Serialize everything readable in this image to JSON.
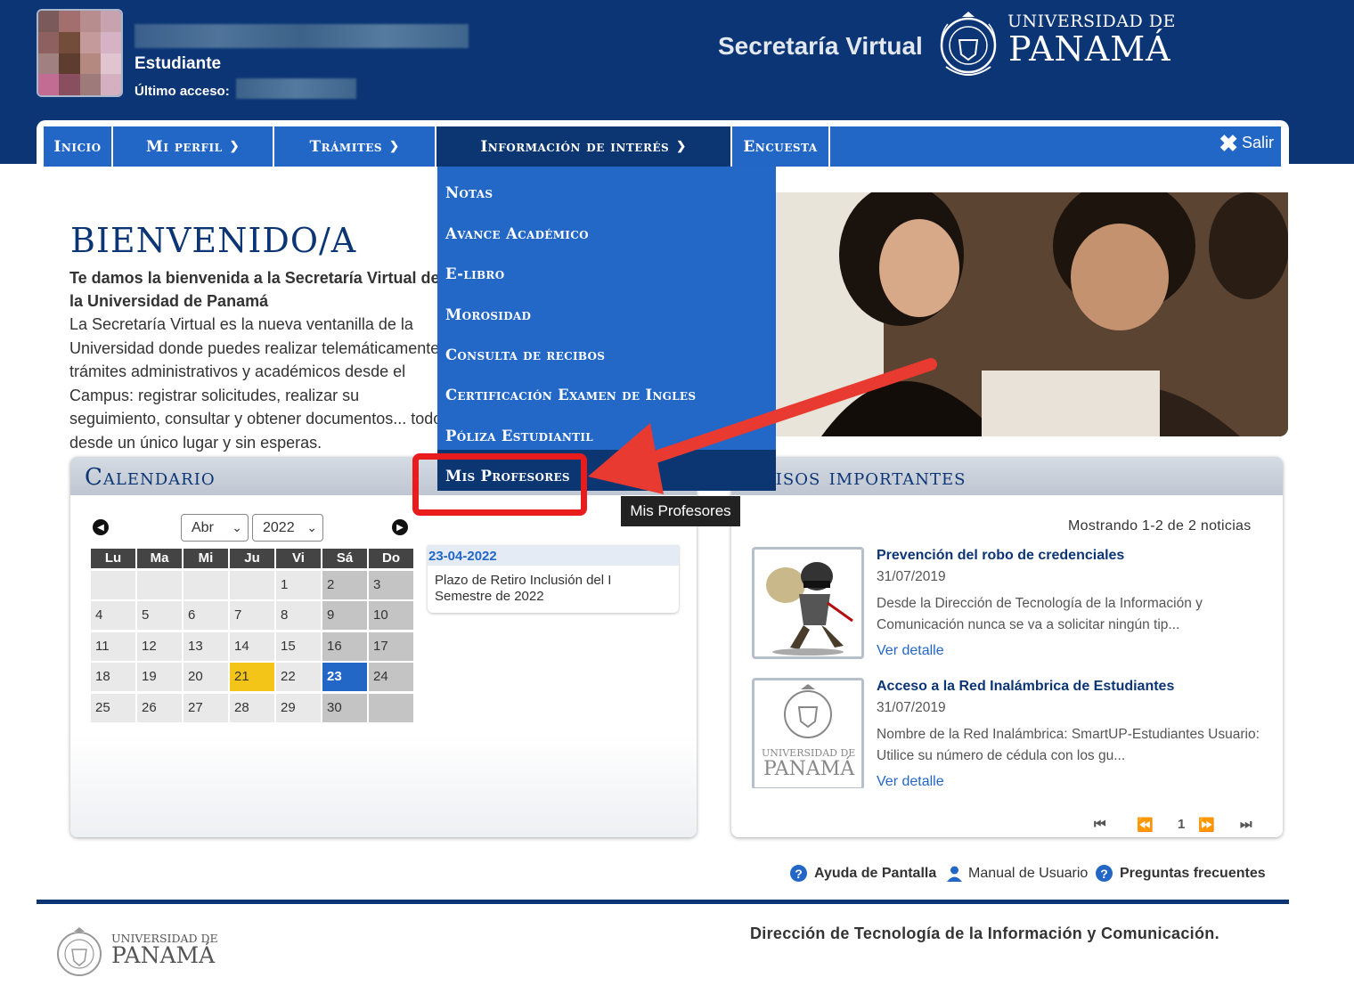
{
  "header": {
    "role": "Estudiante",
    "last_access_label": "Último acceso:",
    "app_title": "Secretaría Virtual",
    "univ_small": "UNIVERSIDAD DE",
    "univ_big": "PANAMÁ"
  },
  "nav": {
    "items": [
      {
        "label": "Inicio"
      },
      {
        "label": "Mi perfil"
      },
      {
        "label": "Trámites"
      },
      {
        "label": "Información de interés"
      },
      {
        "label": "Encuesta"
      }
    ],
    "logout_label": "Salir"
  },
  "dropdown": {
    "items": [
      {
        "label": "Notas"
      },
      {
        "label": "Avance Académico"
      },
      {
        "label": "E-libro"
      },
      {
        "label": "Morosidad"
      },
      {
        "label": "Consulta de recibos"
      },
      {
        "label": "Certificación Examen de Ingles"
      },
      {
        "label": "Póliza Estudiantil"
      },
      {
        "label": "Mis Profesores"
      }
    ],
    "tooltip": "Mis Profesores"
  },
  "welcome": {
    "title": "BIENVENIDO/A",
    "lead": "Te damos la bienvenida a la Secretaría Virtual de la Universidad de Panamá",
    "body": "La Secretaría Virtual es la nueva ventanilla de la Universidad donde puedes realizar telemáticamente trámites administrativos y académicos desde el Campus: registrar solicitudes, realizar su seguimiento, consultar y obtener documentos... todo desde un único lugar y sin esperas."
  },
  "calendar": {
    "title": "Calendario",
    "month": "Abr",
    "year": "2022",
    "weekdays": [
      "Lu",
      "Ma",
      "Mi",
      "Ju",
      "Vi",
      "Sá",
      "Do"
    ],
    "weeks": [
      [
        "",
        "",
        "",
        "",
        "1",
        "2",
        "3"
      ],
      [
        "4",
        "5",
        "6",
        "7",
        "8",
        "9",
        "10"
      ],
      [
        "11",
        "12",
        "13",
        "14",
        "15",
        "16",
        "17"
      ],
      [
        "18",
        "19",
        "20",
        "21",
        "22",
        "23",
        "24"
      ],
      [
        "25",
        "26",
        "27",
        "28",
        "29",
        "30",
        ""
      ]
    ],
    "today": "21",
    "selected": "23",
    "event_date": "23-04-2022",
    "event_text": "Plazo de Retiro Inclusión del I Semestre de 2022"
  },
  "news": {
    "title": "Avisos importantes",
    "count": "Mostrando 1-2 de 2 noticias",
    "items": [
      {
        "title": "Prevención del robo de credenciales",
        "date": "31/07/2019",
        "desc": "Desde la Dirección de Tecnología de la Información y Comunicación nunca se va a solicitar ningún tip...",
        "link": "Ver detalle"
      },
      {
        "title": "Acceso a la Red Inalámbrica de Estudiantes",
        "date": "31/07/2019",
        "desc": "Nombre de la Red Inalámbrica: SmartUP-Estudiantes Usuario: Utilice su número de cédula con los gu...",
        "link": "Ver detalle"
      }
    ],
    "thumb2_small": "UNIVERSIDAD DE",
    "thumb2_big": "PANAMÁ",
    "page": "1"
  },
  "help": {
    "screen_help": "Ayuda de Pantalla",
    "manual": "Manual de Usuario",
    "faq": "Preguntas frecuentes"
  },
  "footer": {
    "text": "Dirección de Tecnología de la Información y Comunicación.",
    "univ_small": "UNIVERSIDAD DE",
    "univ_big": "PANAMÁ"
  },
  "colors": {
    "primary": "#0c3575",
    "nav": "#2367c6",
    "highlight": "#e81c1c",
    "today": "#f2c518"
  }
}
